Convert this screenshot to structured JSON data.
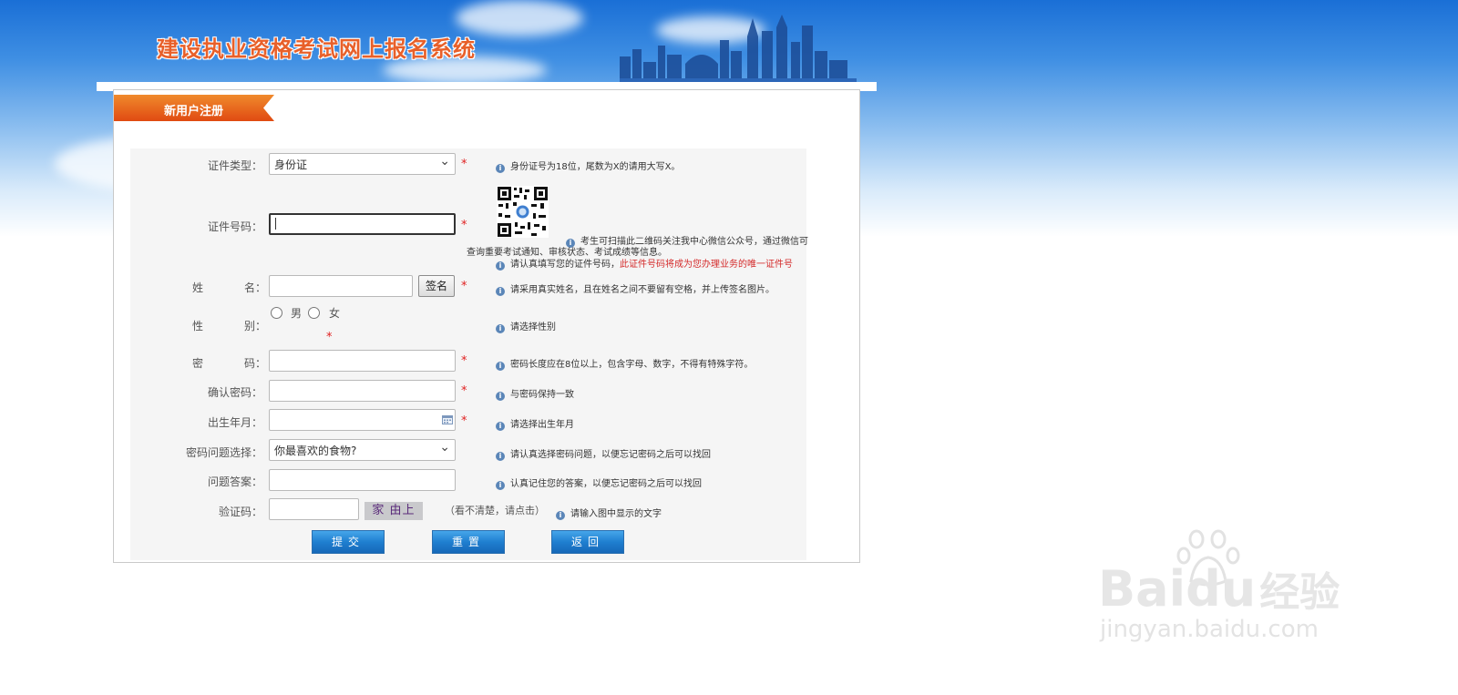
{
  "header": {
    "site_title": "建设执业资格考试网上报名系统"
  },
  "tab": {
    "label": "新用户注册"
  },
  "form": {
    "id_type": {
      "label": "证件类型：",
      "value": "身份证",
      "hint": "身份证号为18位，尾数为X的请用大写X。"
    },
    "id_number": {
      "label": "证件号码：",
      "value": "",
      "hint_qr": "考生可扫描此二维码关注我中心微信公众号，通过微信可",
      "hint_qr2": "查询重要考试通知、审核状态、考试成绩等信息。",
      "hint_main": "请认真填写您的证件号码，",
      "hint_red": "此证件号码将成为您办理业务的唯一证件号"
    },
    "name": {
      "label_a": "姓",
      "label_b": "名：",
      "value": "",
      "sign_button": "签名",
      "hint": "请采用真实姓名，且在姓名之间不要留有空格，并上传签名图片。"
    },
    "gender": {
      "label_a": "性",
      "label_b": "别：",
      "options": [
        "男",
        "女"
      ],
      "hint": "请选择性别"
    },
    "password": {
      "label_a": "密",
      "label_b": "码：",
      "value": "",
      "hint": "密码长度应在8位以上，包含字母、数字，不得有特殊字符。"
    },
    "confirm_password": {
      "label": "确认密码：",
      "value": "",
      "hint": "与密码保持一致"
    },
    "birth": {
      "label": "出生年月：",
      "value": "",
      "hint": "请选择出生年月"
    },
    "question": {
      "label": "密码问题选择：",
      "value": "你最喜欢的食物?",
      "hint": "请认真选择密码问题，以便忘记密码之后可以找回"
    },
    "answer": {
      "label": "问题答案：",
      "value": "",
      "hint": "认真记住您的答案，以便忘记密码之后可以找回"
    },
    "captcha": {
      "label": "验证码：",
      "value": "",
      "image_text": "家 由上",
      "refresh": "（看不清楚，请点击）",
      "hint": "请输入图中显示的文字"
    },
    "required_mark": "*",
    "info_icon": "i"
  },
  "buttons": {
    "submit": "提交",
    "reset": "重置",
    "back": "返回"
  },
  "watermark": {
    "main": "Bai",
    "main2": "du",
    "cn": "经验",
    "sub": "jingyan.baidu.com"
  }
}
